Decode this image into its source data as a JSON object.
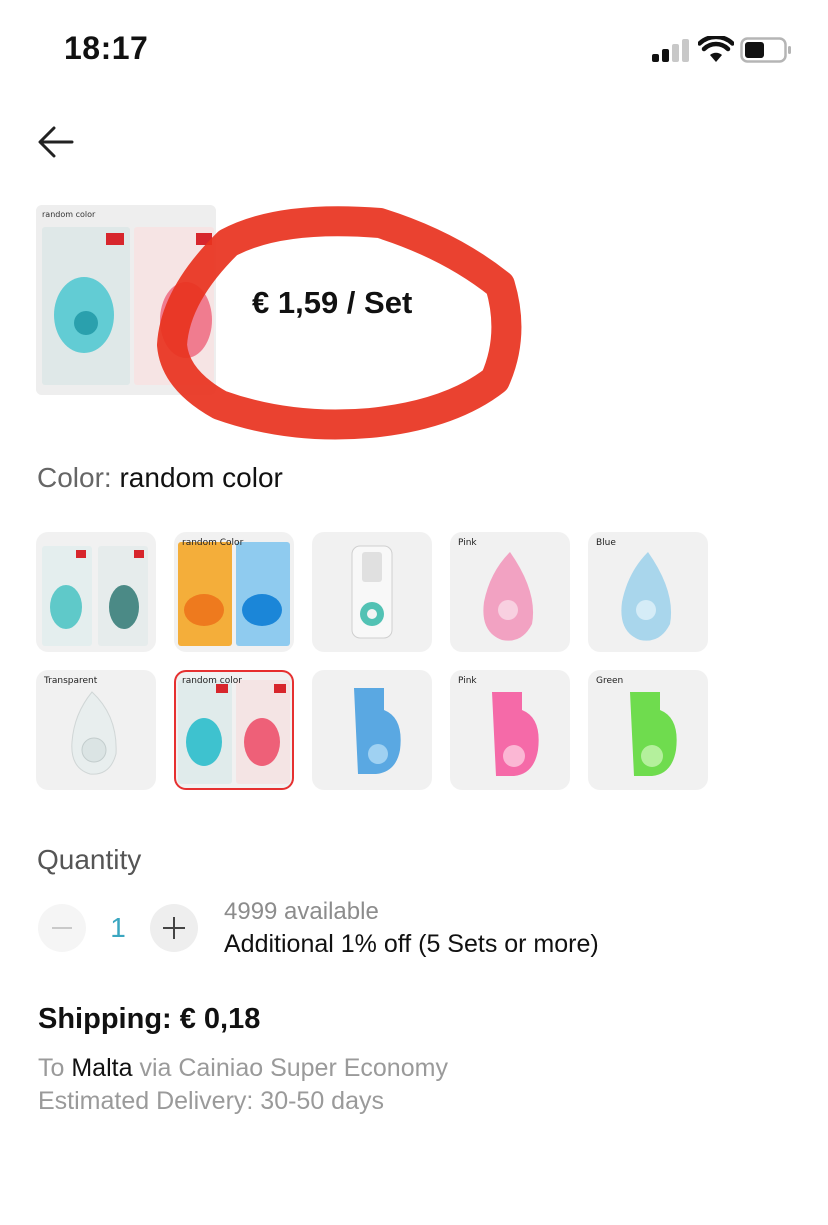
{
  "status_bar": {
    "time": "18:17"
  },
  "icons": {
    "back": "back-arrow-icon",
    "signal": "cellular-signal-icon",
    "wifi": "wifi-icon",
    "battery": "battery-icon",
    "minus": "minus-icon",
    "plus": "plus-icon"
  },
  "product": {
    "main_thumb_caption": "random color",
    "price": "€ 1,59 / Set",
    "annotation_color": "#e8321e"
  },
  "color": {
    "label": "Color: ",
    "value": "random color",
    "options": [
      {
        "tag": ""
      },
      {
        "tag": "random Color"
      },
      {
        "tag": ""
      },
      {
        "tag": "Pink"
      },
      {
        "tag": "Blue"
      },
      {
        "tag": "Transparent"
      },
      {
        "tag": "random color",
        "selected": true
      },
      {
        "tag": ""
      },
      {
        "tag": "Pink"
      },
      {
        "tag": "Green"
      }
    ],
    "selected_border": "#e63030"
  },
  "quantity": {
    "title": "Quantity",
    "value": "1",
    "available": "4999 available",
    "discount": "Additional 1% off (5 Sets or more)"
  },
  "shipping": {
    "title": "Shipping: € 0,18",
    "to_prefix": "To ",
    "destination": "Malta",
    "via": " via Cainiao Super Economy",
    "delivery": "Estimated Delivery: 30-50 days"
  }
}
